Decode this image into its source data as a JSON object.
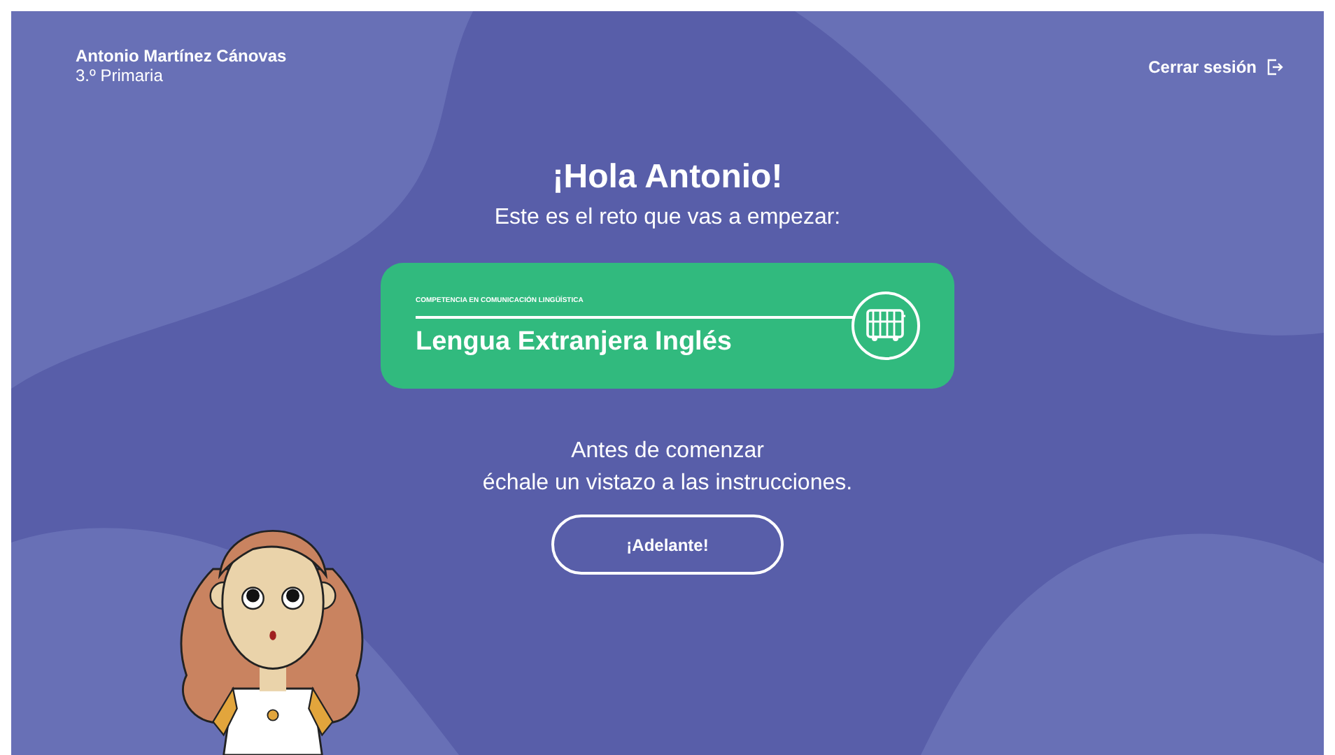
{
  "user": {
    "name": "Antonio Martínez Cánovas",
    "grade": "3.º Primaria"
  },
  "logout": {
    "label": "Cerrar sesión"
  },
  "greeting": "¡Hola Antonio!",
  "intro": "Este es el reto que vas a empezar:",
  "challenge": {
    "category": "COMPETENCIA EN COMUNICACIÓN LINGÜÍSTICA",
    "title": "Lengua Extranjera Inglés"
  },
  "instructions": [
    "Antes de comenzar",
    "échale un vistazo a las instrucciones."
  ],
  "start_button": "¡Adelante!"
}
